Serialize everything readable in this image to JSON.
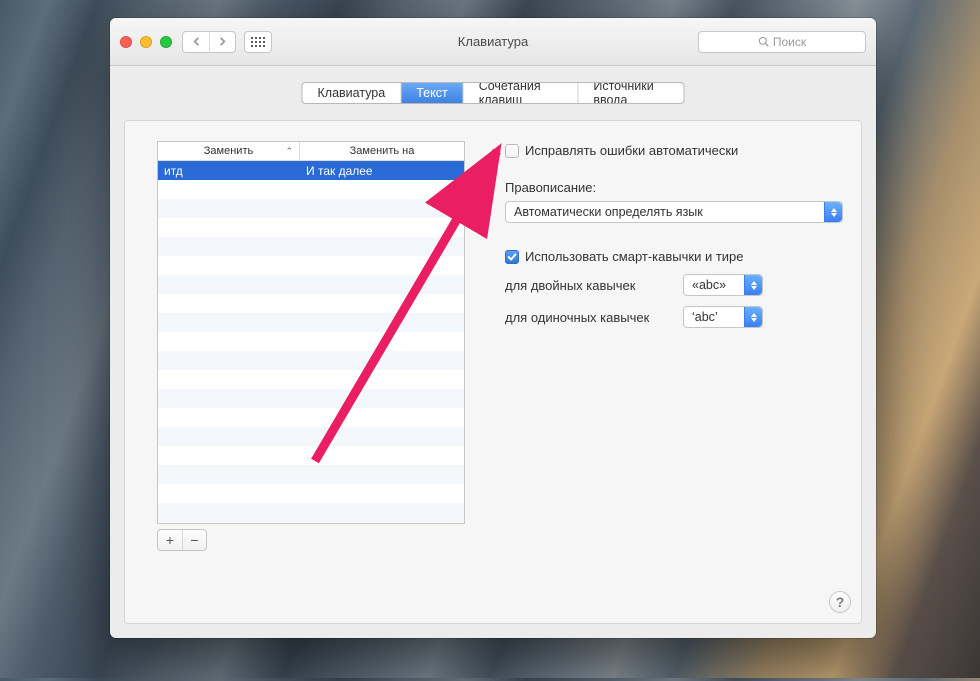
{
  "window": {
    "title": "Клавиатура"
  },
  "toolbar": {
    "search_placeholder": "Поиск"
  },
  "tabs": {
    "keyboard": "Клавиатура",
    "text": "Текст",
    "shortcuts": "Сочетания клавиш",
    "sources": "Источники ввода",
    "active": "text"
  },
  "table": {
    "header_replace": "Заменить",
    "header_with": "Заменить на",
    "rows": [
      {
        "from": "итд",
        "to": "И так далее"
      }
    ],
    "add_label": "+",
    "remove_label": "−"
  },
  "options": {
    "auto_correct": {
      "label": "Исправлять ошибки автоматически",
      "checked": false
    },
    "spelling_label": "Правописание:",
    "spelling_value": "Автоматически определять язык",
    "smart_quotes": {
      "label": "Использовать смарт‑кавычки и тире",
      "checked": true
    },
    "double_label": "для двойных кавычек",
    "double_value": "«abc»",
    "single_label": "для одиночных кавычек",
    "single_value": "‘abc’"
  },
  "help": "?"
}
